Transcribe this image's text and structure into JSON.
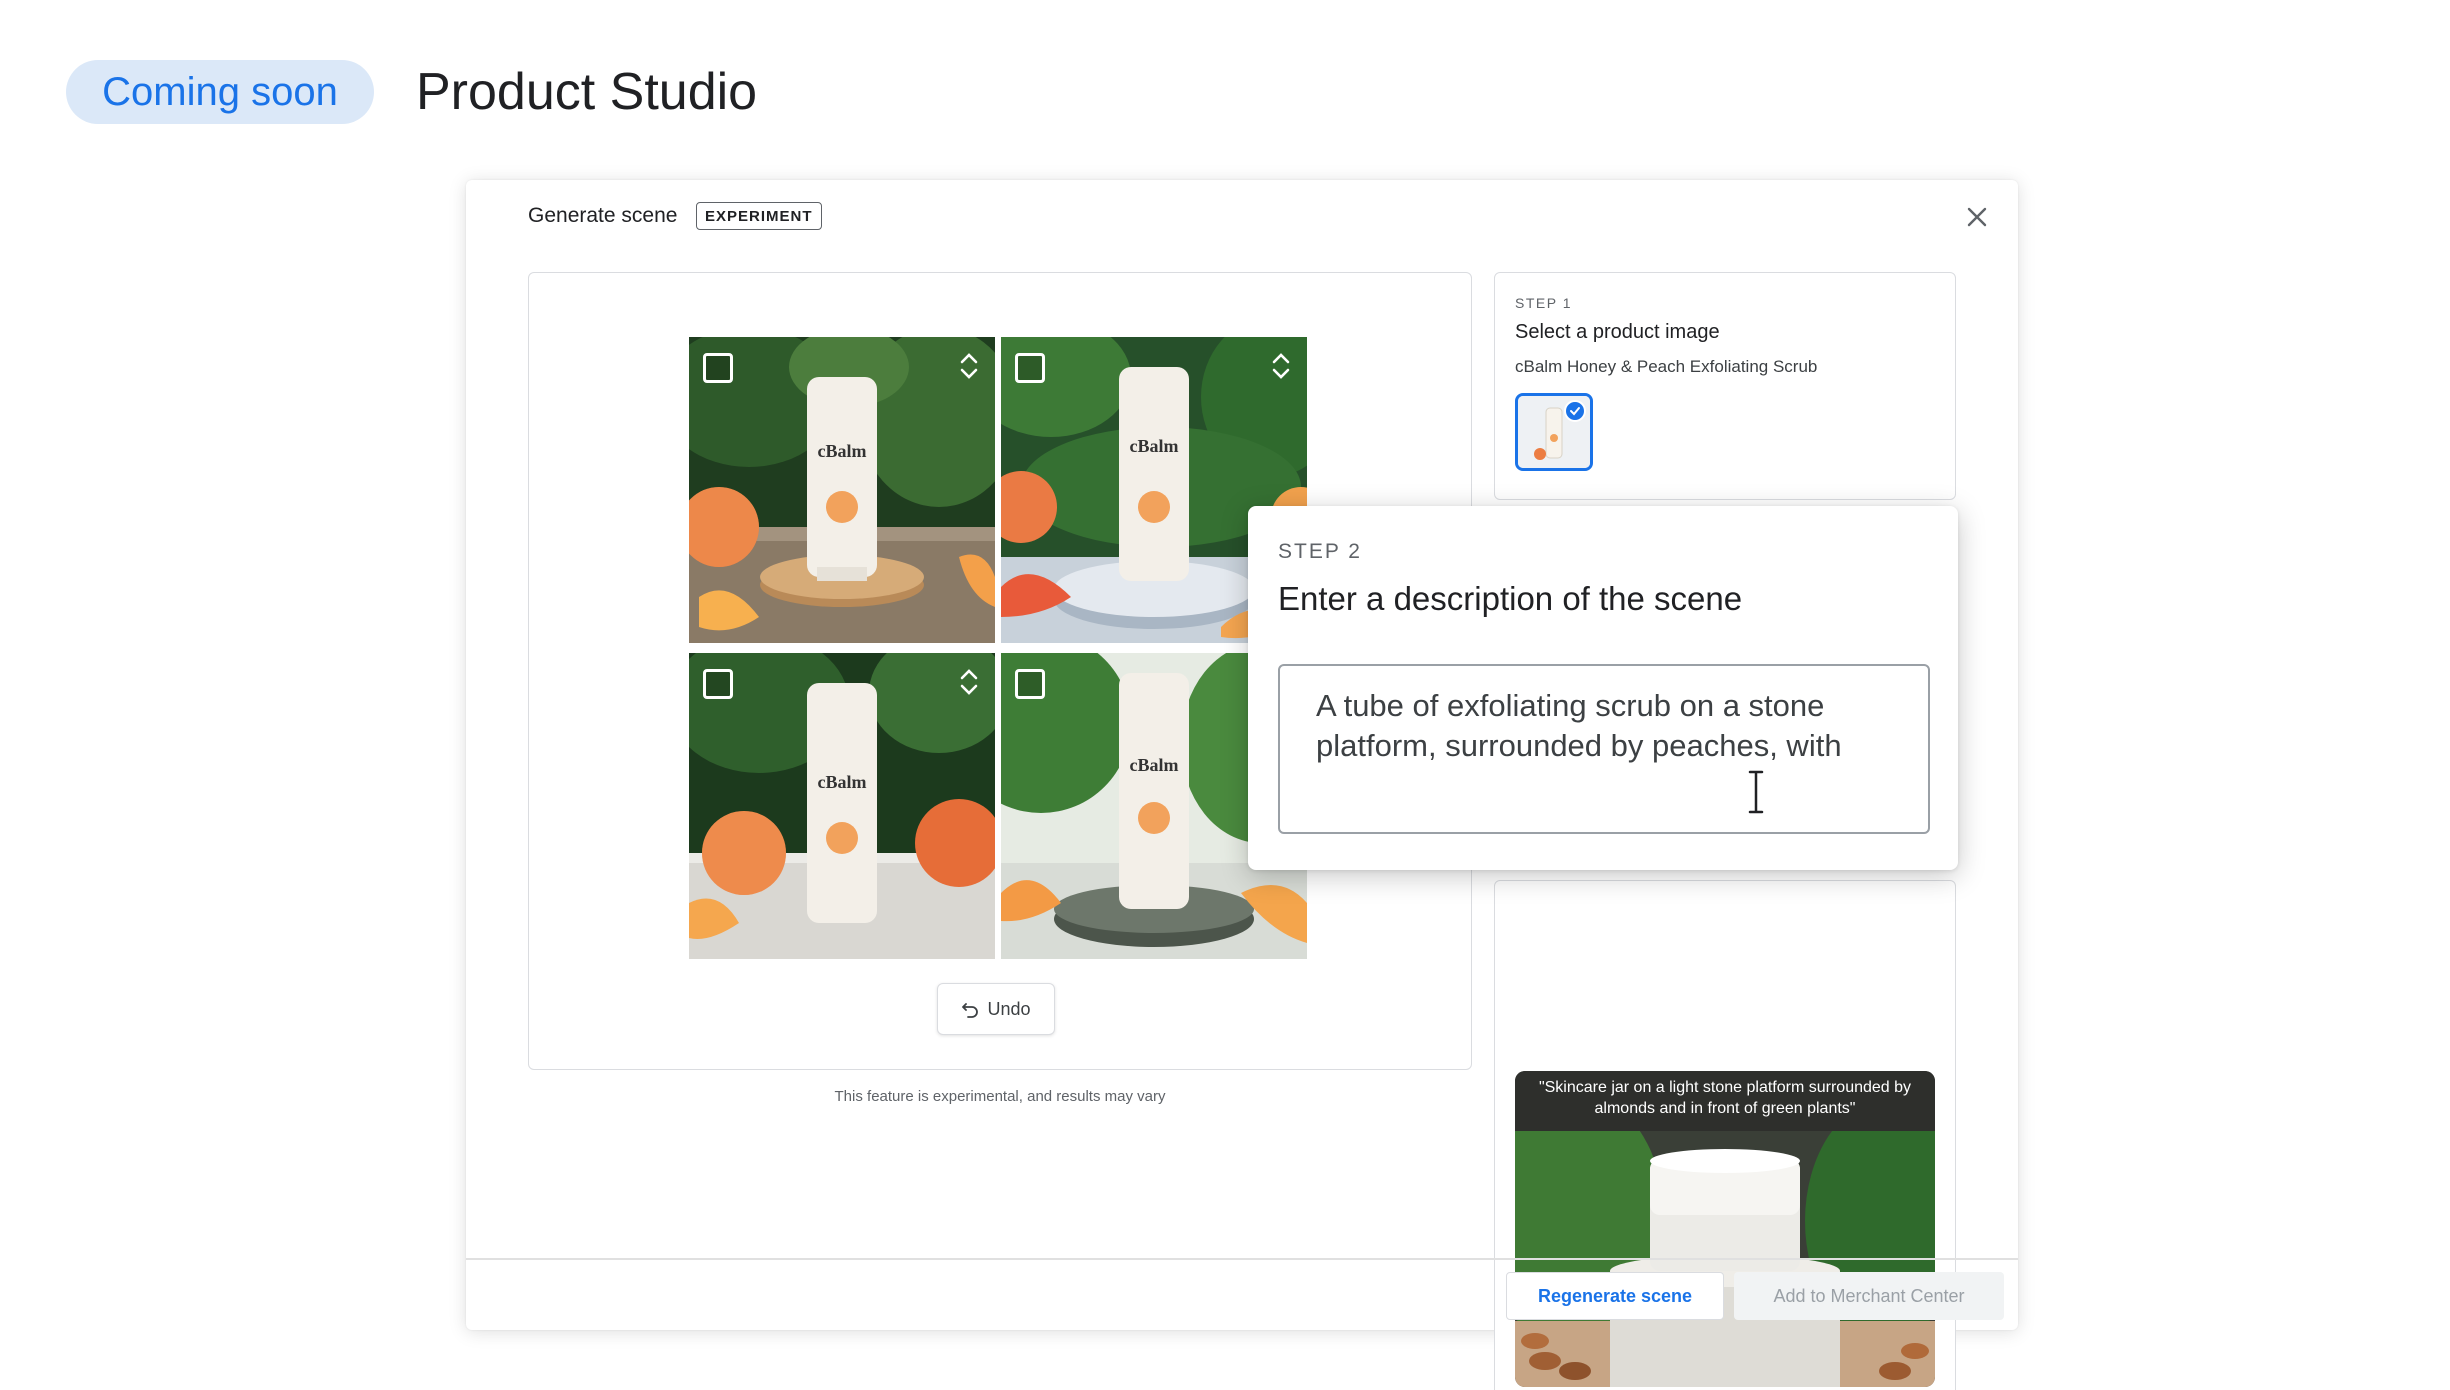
{
  "header": {
    "badge": "Coming soon",
    "title": "Product Studio"
  },
  "dialog": {
    "title": "Generate scene",
    "tag": "EXPERIMENT",
    "close_icon": "close-icon",
    "undo_label": "Undo",
    "disclaimer": "This feature is experimental, and results may vary",
    "step1": {
      "label": "STEP 1",
      "title": "Select a product image",
      "product_name": "cBalm Honey & Peach Exfoliating Scrub"
    },
    "step2": {
      "label": "STEP 2",
      "title": "Enter a description of the scene",
      "input_value": "A tube of exfoliating scrub on a stone platform, surrounded by peaches, with"
    },
    "example": {
      "caption": "\"Skincare jar on a light stone platform surrounded by almonds and in front of green plants\""
    },
    "buttons": {
      "regenerate": "Regenerate scene",
      "add_to_merchant": "Add to Merchant Center"
    },
    "tiles": [
      {
        "brand": "cBalm",
        "name": "tile-1"
      },
      {
        "brand": "cBalm",
        "name": "tile-2"
      },
      {
        "brand": "cBalm",
        "name": "tile-3"
      },
      {
        "brand": "cBalm",
        "name": "tile-4"
      }
    ]
  },
  "colors": {
    "accent": "#1a73e8",
    "badge_bg": "#dbe8f8",
    "border": "#dadce0"
  }
}
